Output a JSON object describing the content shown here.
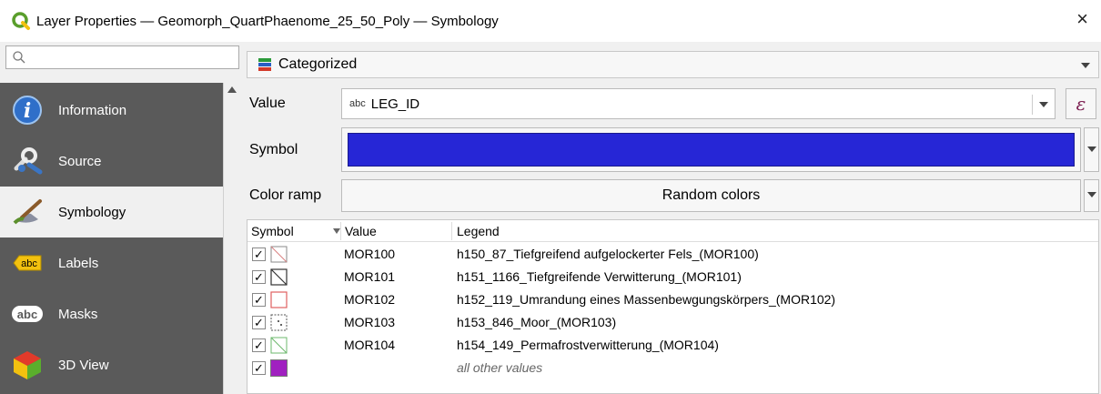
{
  "window": {
    "title": "Layer Properties — Geomorph_QuartPhaenome_25_50_Poly — Symbology",
    "close_glyph": "×"
  },
  "search": {
    "placeholder": ""
  },
  "sidebar": {
    "items": [
      {
        "label": "Information",
        "icon": "information-icon"
      },
      {
        "label": "Source",
        "icon": "source-icon"
      },
      {
        "label": "Symbology",
        "icon": "symbology-icon",
        "active": true
      },
      {
        "label": "Labels",
        "icon": "labels-icon"
      },
      {
        "label": "Masks",
        "icon": "masks-icon"
      },
      {
        "label": "3D View",
        "icon": "3d-view-icon"
      }
    ]
  },
  "renderer": {
    "label": "Categorized"
  },
  "form": {
    "value_label": "Value",
    "value_prefix": "abc",
    "value_field": "LEG_ID",
    "expression_glyph": "ε",
    "symbol_label": "Symbol",
    "symbol_color": "#2626d6",
    "color_ramp_label": "Color ramp",
    "color_ramp_value": "Random colors"
  },
  "table": {
    "headers": [
      "Symbol",
      "Value",
      "Legend"
    ],
    "rows": [
      {
        "checked": true,
        "value": "MOR100",
        "legend": "h150_87_Tiefgreifend aufgelockerter Fels_(MOR100)",
        "symbol": "diag-red"
      },
      {
        "checked": true,
        "value": "MOR101",
        "legend": "h151_1166_Tiefgreifende Verwitterung_(MOR101)",
        "symbol": "diag-dark"
      },
      {
        "checked": true,
        "value": "MOR102",
        "legend": "h152_119_Umrandung eines Massenbewgungskörpers_(MOR102)",
        "symbol": "red-outline"
      },
      {
        "checked": true,
        "value": "MOR103",
        "legend": "h153_846_Moor_(MOR103)",
        "symbol": "dots"
      },
      {
        "checked": true,
        "value": "MOR104",
        "legend": "h154_149_Permafrostverwitterung_(MOR104)",
        "symbol": "diag-green"
      },
      {
        "checked": true,
        "value": "",
        "legend": "all other values",
        "symbol": "purple-fill"
      }
    ],
    "check_glyph": "✓"
  },
  "colors": {
    "accent_purple": "#a020c0",
    "sidebar_bg": "#5a5a5a"
  }
}
